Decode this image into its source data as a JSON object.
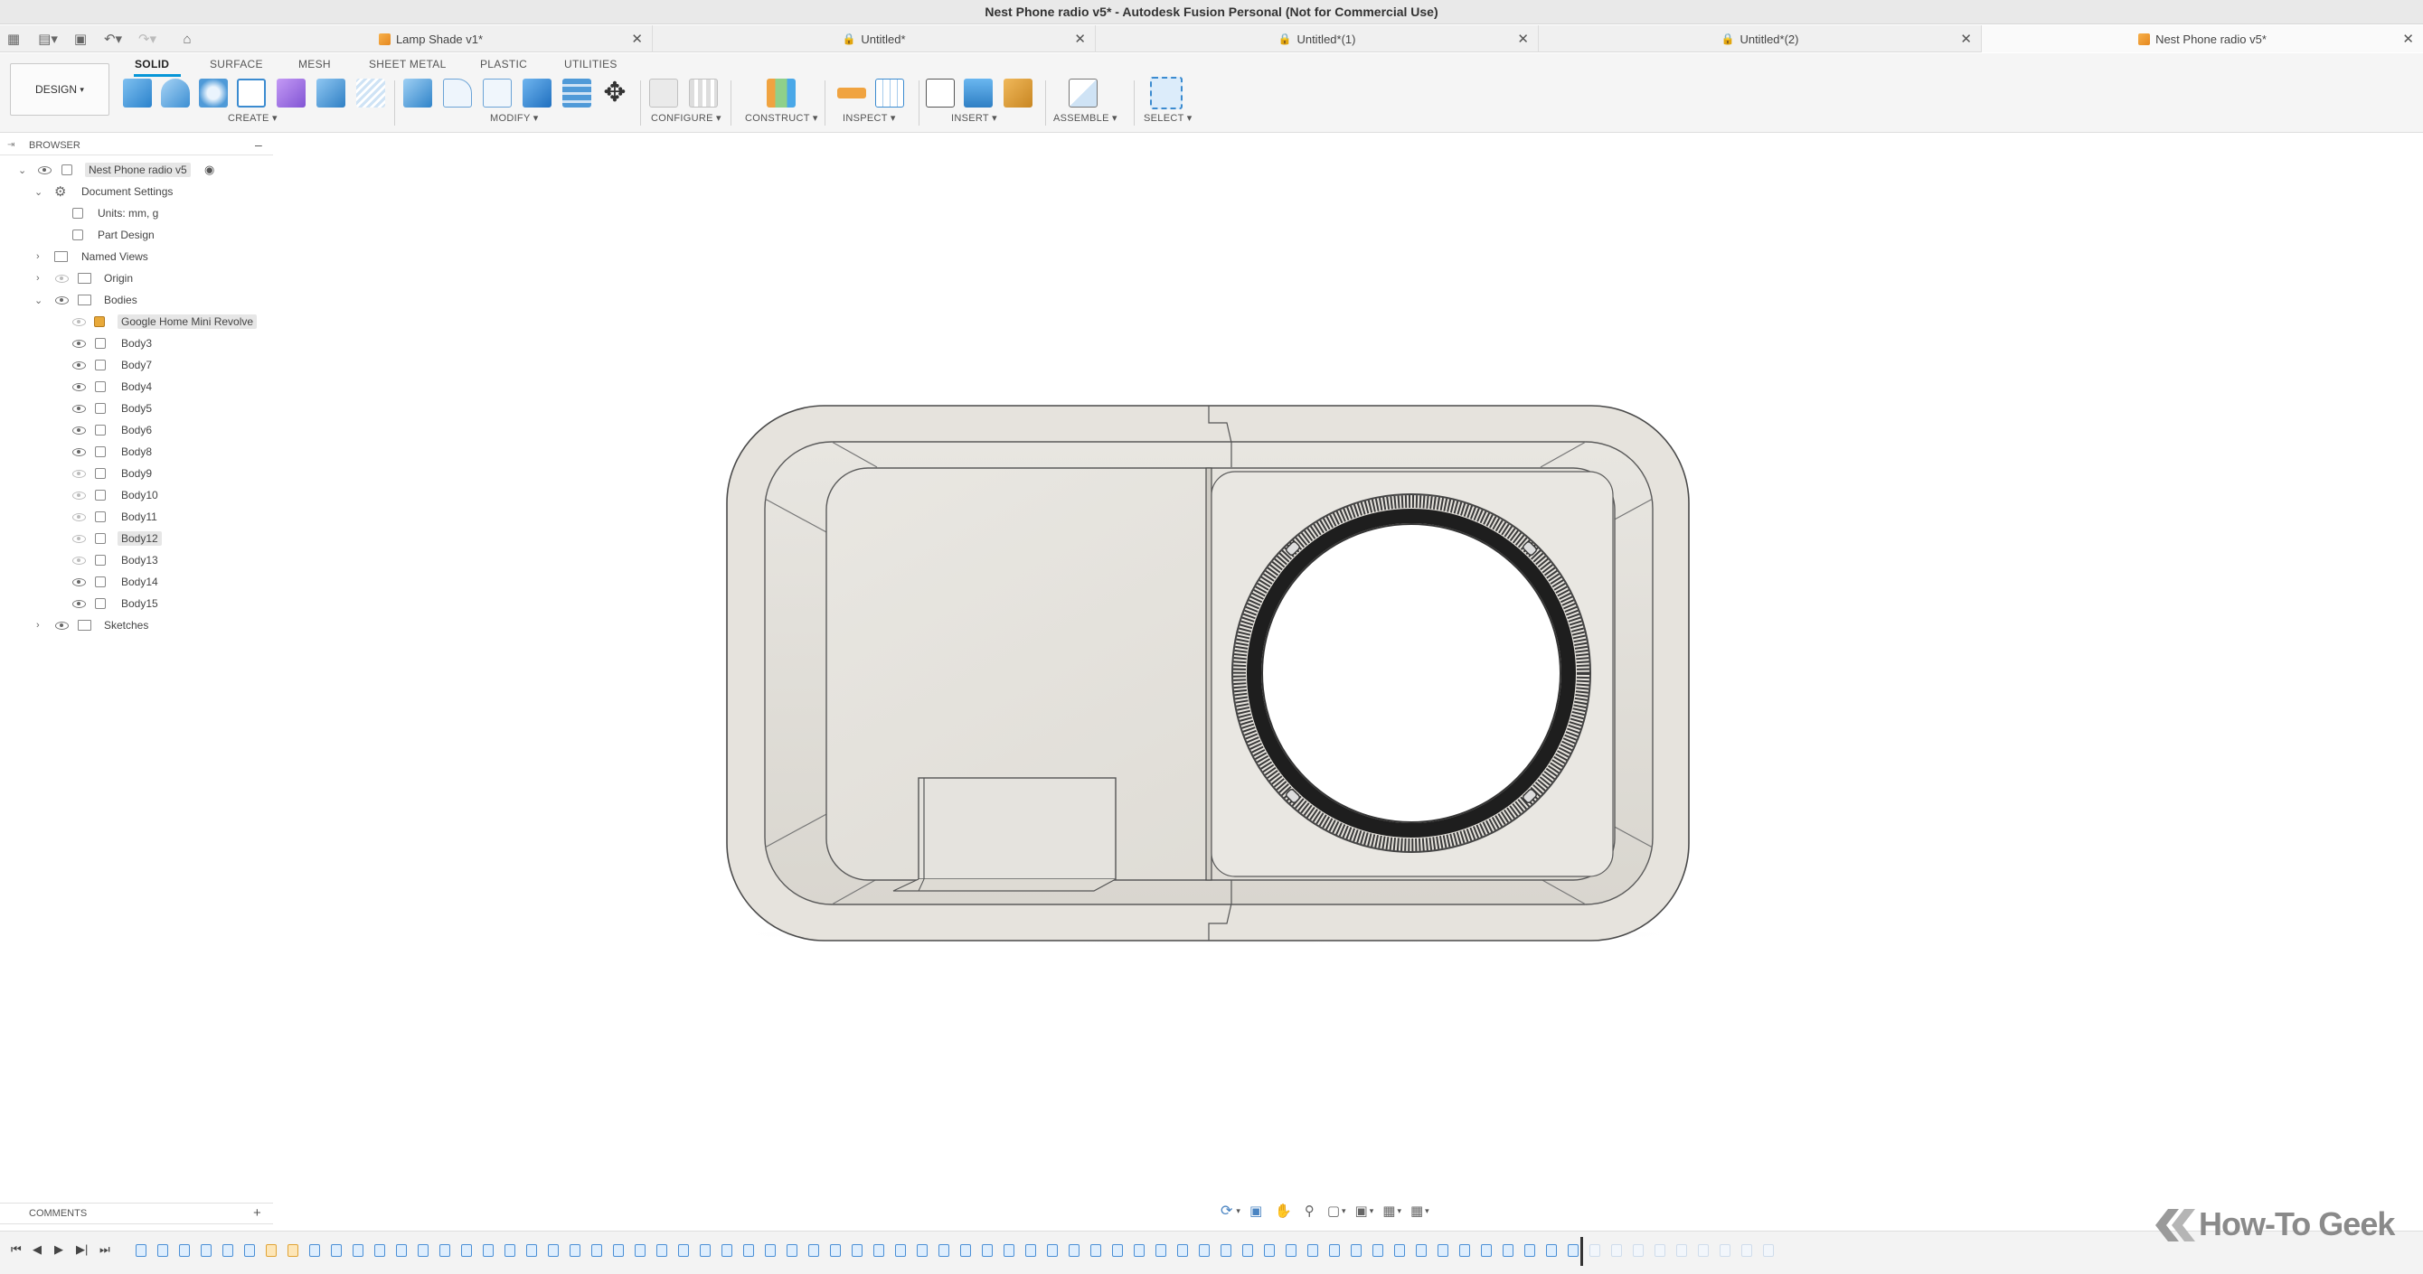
{
  "window": {
    "title": "Nest Phone radio v5* - Autodesk Fusion Personal (Not for Commercial Use)"
  },
  "tabs": [
    {
      "label": "Lamp Shade v1*",
      "icon": "orange-cube-icon"
    },
    {
      "label": "Untitled*",
      "icon": "lock-icon"
    },
    {
      "label": "Untitled*(1)",
      "icon": "lock-icon"
    },
    {
      "label": "Untitled*(2)",
      "icon": "lock-icon"
    },
    {
      "label": "Nest Phone radio v5*",
      "icon": "orange-cube-icon",
      "active": true
    }
  ],
  "toolbar": {
    "workspace": "DESIGN",
    "ribbon_tabs": [
      "SOLID",
      "SURFACE",
      "MESH",
      "SHEET METAL",
      "PLASTIC",
      "UTILITIES"
    ],
    "active_tab": "SOLID",
    "groups": [
      "CREATE",
      "MODIFY",
      "CONFIGURE",
      "CONSTRUCT",
      "INSPECT",
      "INSERT",
      "ASSEMBLE",
      "SELECT"
    ]
  },
  "browser": {
    "title": "BROWSER",
    "root": "Nest Phone radio v5",
    "document_settings": "Document Settings",
    "units": "Units: mm, g",
    "part_design": "Part Design",
    "named_views": "Named Views",
    "origin": "Origin",
    "bodies": "Bodies",
    "body_items": [
      {
        "label": "Google Home Mini Revolve",
        "visible": false
      },
      {
        "label": "Body3",
        "visible": true
      },
      {
        "label": "Body7",
        "visible": true
      },
      {
        "label": "Body4",
        "visible": true
      },
      {
        "label": "Body5",
        "visible": true
      },
      {
        "label": "Body6",
        "visible": true
      },
      {
        "label": "Body8",
        "visible": true
      },
      {
        "label": "Body9",
        "visible": false
      },
      {
        "label": "Body10",
        "visible": false
      },
      {
        "label": "Body11",
        "visible": false
      },
      {
        "label": "Body12",
        "visible": false
      },
      {
        "label": "Body13",
        "visible": false
      },
      {
        "label": "Body14",
        "visible": true
      },
      {
        "label": "Body15",
        "visible": true
      }
    ],
    "sketches": "Sketches"
  },
  "comments": {
    "label": "COMMENTS"
  },
  "watermark": {
    "text": "How-To Geek"
  },
  "colors": {
    "accent": "#0696d7",
    "model_fill": "#e4e1da",
    "model_edge": "#5a5a5a"
  }
}
